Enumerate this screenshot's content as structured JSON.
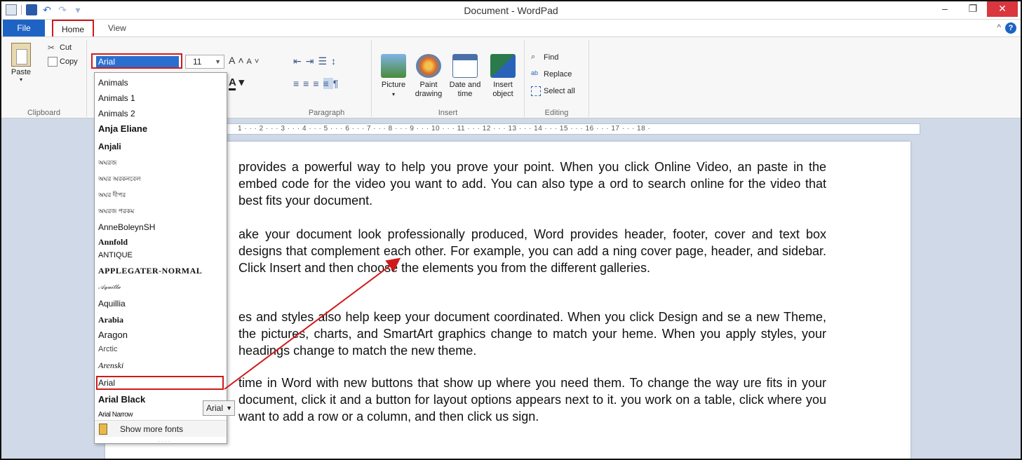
{
  "window": {
    "title": "Document - WordPad"
  },
  "tabs": {
    "file": "File",
    "home": "Home",
    "view": "View"
  },
  "clipboard": {
    "paste": "Paste",
    "cut": "Cut",
    "copy": "Copy",
    "group": "Clipboard"
  },
  "font": {
    "current": "Arial",
    "size": "11"
  },
  "paragraph": {
    "group": "Paragraph"
  },
  "insert": {
    "picture": "Picture",
    "paint1": "Paint",
    "paint2": "drawing",
    "date1": "Date and",
    "date2": "time",
    "object1": "Insert",
    "object2": "object",
    "group": "Insert"
  },
  "editing": {
    "find": "Find",
    "replace": "Replace",
    "select_all": "Select all",
    "group": "Editing"
  },
  "ruler": "1 · · · 2 · · · 3 · · · 4 · · · 5 · · · 6 · · · 7 · · · 8 · · · 9 · · · 10 · · · 11 · · · 12 · · · 13 · · · 14 · · · 15 · · · 16 · · · 17 · · · 18 ·",
  "font_list": [
    "Animals",
    "Animals 1",
    "Animals 2",
    "Anja Eliane",
    "Anjali",
    "অঘরজ",
    "অঘর অরকনবেল",
    "অঘর দীপর",
    "অঘরজ পরকম",
    "AnneBoleynSH",
    "Annfold",
    "ANTIQUE",
    "APPLEGATER-NORMAL",
    "Aquilla",
    "Aquillia",
    "Arabia",
    "Aragon",
    "Arctic",
    "Arenski",
    "Arial",
    "Arial Black",
    "Arial Narrow"
  ],
  "more_fonts": "Show more fonts",
  "tooltip": "Arial",
  "document": {
    "p1": "provides a powerful way to help you prove your point. When you click Online Video, an paste in the embed code for the video you want to add. You can also type a ord to search online for the video that best fits your document.",
    "p2": "ake your document look professionally produced, Word provides header, footer, cover and text box designs that complement each other. For example, you can add a ning cover page, header, and sidebar. Click Insert and then choose the elements you from the different galleries.",
    "p3": "es and styles also help keep your document coordinated. When you click Design and se a new Theme, the pictures, charts, and SmartArt graphics change to match your heme. When you apply styles, your headings change to match the new theme.",
    "p4": "time in Word with new buttons that show up where you need them. To change the way ure fits in your document, click it and a button for layout options appears next to it. you work on a table, click where you want to add a row or a column, and then click us sign."
  },
  "colors": {
    "accent": "#1e63c4",
    "highlight": "#d01a1a"
  }
}
